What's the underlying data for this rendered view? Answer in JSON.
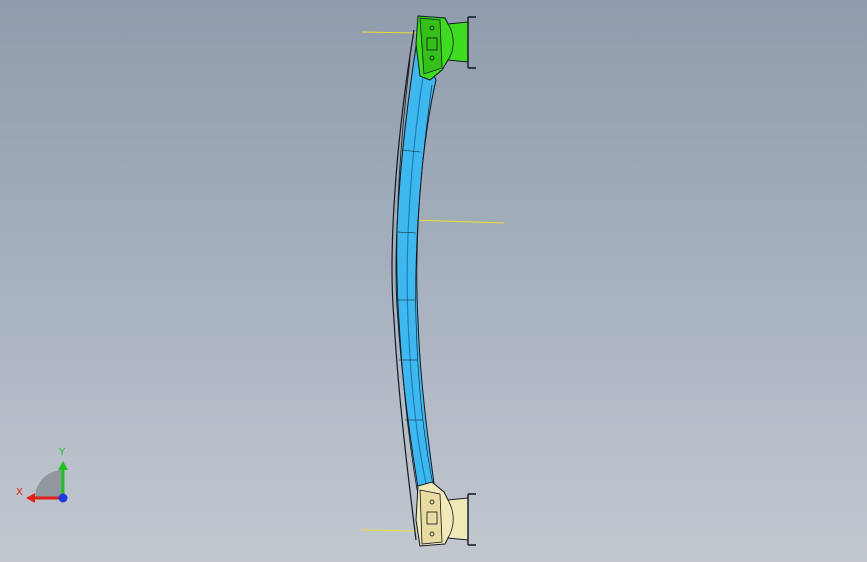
{
  "viewport": {
    "colors": {
      "bumper_beam": "#3fb8f0",
      "bumper_beam_dark": "#1c7fb8",
      "bracket_top": "#3ddc1e",
      "bracket_top_dark": "#2a9a10",
      "bracket_bottom": "#f2e9b8",
      "bracket_bottom_dark": "#b9ab6a",
      "outline": "#101820",
      "leader_line": "#e8e030"
    }
  },
  "triad": {
    "x_label": "X",
    "y_label": "Y",
    "colors": {
      "x_axis": "#e0201a",
      "y_axis": "#20c020",
      "z_axis": "#1a3ce0",
      "plane": "#8a8f96"
    }
  }
}
